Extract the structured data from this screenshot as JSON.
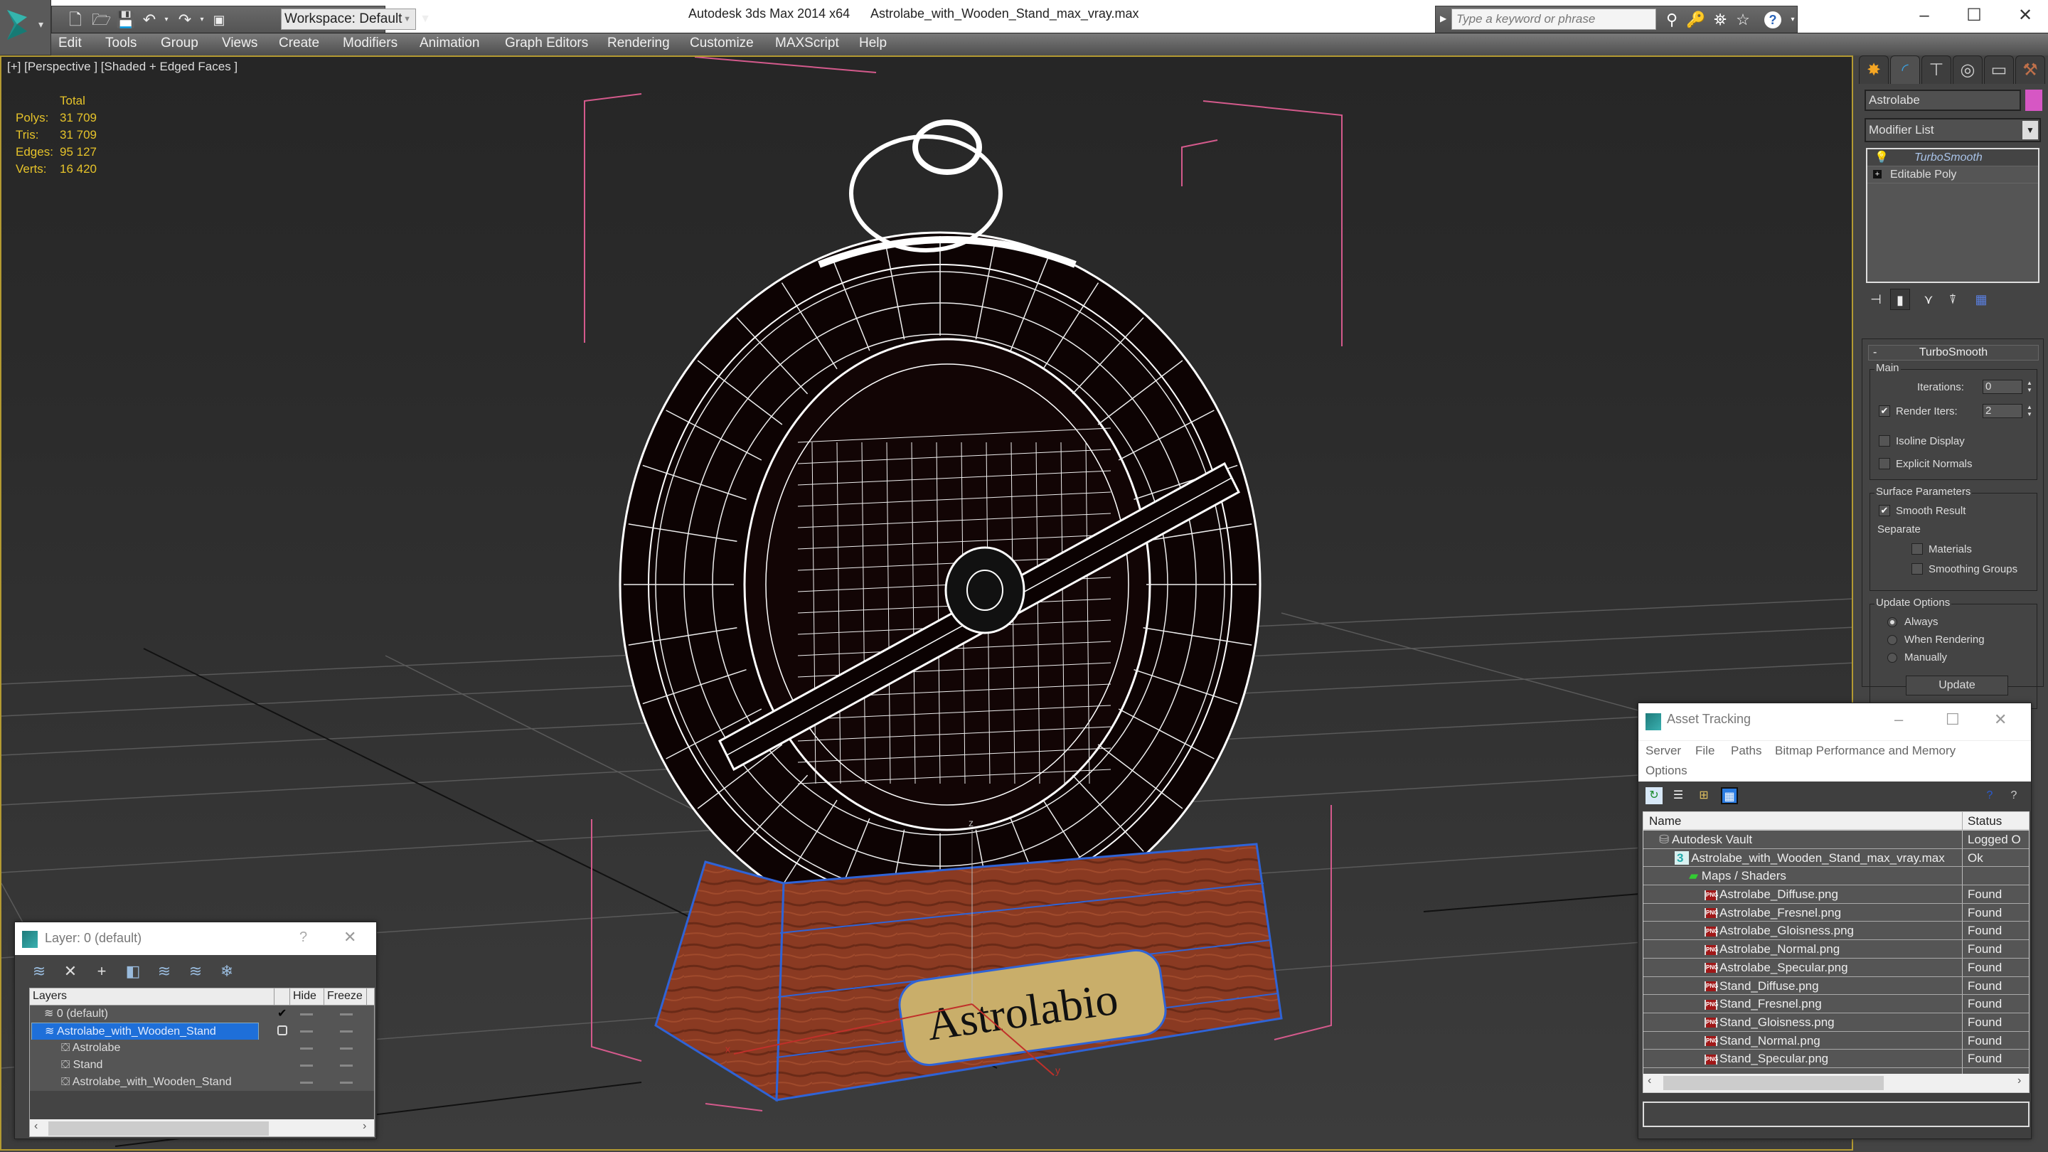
{
  "titlebar": {
    "app_title": "Autodesk 3ds Max  2014 x64",
    "file_title": "Astrolabe_with_Wooden_Stand_max_vray.max",
    "workspace": "Workspace: Default",
    "search_placeholder": "Type a keyword or phrase",
    "quick_access": [
      "new-icon",
      "open-icon",
      "save-icon",
      "undo-icon",
      "redo-icon",
      "project-folder-icon"
    ],
    "infocenter_icons": [
      "binoculars-icon",
      "key-icon",
      "satellite-icon",
      "star-icon",
      "help-icon"
    ],
    "window_controls": [
      "minimize",
      "maximize",
      "close"
    ]
  },
  "menubar": [
    "Edit",
    "Tools",
    "Group",
    "Views",
    "Create",
    "Modifiers",
    "Animation",
    "Graph Editors",
    "Rendering",
    "Customize",
    "MAXScript",
    "Help"
  ],
  "viewport": {
    "label": "[+] [Perspective ] [Shaded + Edged Faces ]",
    "stats": {
      "header": "Total",
      "rows": [
        {
          "key": "Polys:",
          "value": "31 709"
        },
        {
          "key": "Tris:",
          "value": "31 709"
        },
        {
          "key": "Edges:",
          "value": "95 127"
        },
        {
          "key": "Verts:",
          "value": "16 420"
        }
      ]
    },
    "nameplate_text": "Astrolabio",
    "axis_labels": {
      "x": "x",
      "y": "y",
      "z": "z"
    },
    "colors": {
      "border": "#b39a32",
      "stats_text": "#e6c32a",
      "wireframe": "#ffffff",
      "selection_bracket": "#d45a8c",
      "stand_wire": "#2f63d6",
      "wood": "#8a3a22",
      "plate": "#c9ae6a"
    }
  },
  "command_panel": {
    "tabs": [
      "create",
      "modify",
      "hierarchy",
      "motion",
      "display",
      "utilities"
    ],
    "active_tab": "modify",
    "object_name": "Astrolabe",
    "object_color": "#d657c4",
    "modifier_list_label": "Modifier List",
    "stack": [
      {
        "label": "TurboSmooth",
        "selected": true
      },
      {
        "label": "Editable Poly",
        "selected": false
      }
    ],
    "rollout": {
      "title": "TurboSmooth",
      "main": {
        "label": "Main",
        "iterations_label": "Iterations:",
        "iterations": "0",
        "render_iters_label": "Render Iters:",
        "render_iters": "2",
        "render_iters_checked": true,
        "isoline_label": "Isoline Display",
        "isoline_checked": false,
        "explicit_normals_label": "Explicit Normals",
        "explicit_normals_checked": false
      },
      "surface": {
        "label": "Surface Parameters",
        "smooth_result_label": "Smooth Result",
        "smooth_result_checked": true,
        "separate_label": "Separate",
        "materials_label": "Materials",
        "materials_checked": false,
        "smoothing_groups_label": "Smoothing Groups",
        "smoothing_groups_checked": false
      },
      "update": {
        "label": "Update Options",
        "options": [
          "Always",
          "When Rendering",
          "Manually"
        ],
        "selected": "Always",
        "button_label": "Update"
      }
    }
  },
  "asset_tracking": {
    "title": "Asset Tracking",
    "menu": [
      "Server",
      "File",
      "Paths",
      "Bitmap Performance and Memory",
      "Options"
    ],
    "columns": [
      "Name",
      "Status"
    ],
    "rows": [
      {
        "name": "Autodesk Vault",
        "status": "Logged O",
        "level": 0,
        "icon": "vault-icon"
      },
      {
        "name": "Astrolabe_with_Wooden_Stand_max_vray.max",
        "status": "Ok",
        "level": 1,
        "icon": "max-file-icon"
      },
      {
        "name": "Maps / Shaders",
        "status": "",
        "level": 2,
        "icon": "maps-icon"
      },
      {
        "name": "Astrolabe_Diffuse.png",
        "status": "Found",
        "level": 3,
        "icon": "png-icon"
      },
      {
        "name": "Astrolabe_Fresnel.png",
        "status": "Found",
        "level": 3,
        "icon": "png-icon"
      },
      {
        "name": "Astrolabe_Gloisness.png",
        "status": "Found",
        "level": 3,
        "icon": "png-icon"
      },
      {
        "name": "Astrolabe_Normal.png",
        "status": "Found",
        "level": 3,
        "icon": "png-icon"
      },
      {
        "name": "Astrolabe_Specular.png",
        "status": "Found",
        "level": 3,
        "icon": "png-icon"
      },
      {
        "name": "Stand_Diffuse.png",
        "status": "Found",
        "level": 3,
        "icon": "png-icon"
      },
      {
        "name": "Stand_Fresnel.png",
        "status": "Found",
        "level": 3,
        "icon": "png-icon"
      },
      {
        "name": "Stand_Gloisness.png",
        "status": "Found",
        "level": 3,
        "icon": "png-icon"
      },
      {
        "name": "Stand_Normal.png",
        "status": "Found",
        "level": 3,
        "icon": "png-icon"
      },
      {
        "name": "Stand_Specular.png",
        "status": "Found",
        "level": 3,
        "icon": "png-icon"
      }
    ]
  },
  "layer_dialog": {
    "title": "Layer: 0 (default)",
    "help": "?",
    "columns": [
      "Layers",
      "",
      "Hide",
      "Freeze"
    ],
    "rows": [
      {
        "name": "0 (default)",
        "level": 0,
        "current": true,
        "selected": false,
        "type": "layer"
      },
      {
        "name": "Astrolabe_with_Wooden_Stand",
        "level": 0,
        "current": false,
        "selected": true,
        "type": "layer",
        "expanded": true
      },
      {
        "name": "Astrolabe",
        "level": 1,
        "selected": false,
        "type": "object"
      },
      {
        "name": "Stand",
        "level": 1,
        "selected": false,
        "type": "object"
      },
      {
        "name": "Astrolabe_with_Wooden_Stand",
        "level": 1,
        "selected": false,
        "type": "object"
      }
    ]
  }
}
